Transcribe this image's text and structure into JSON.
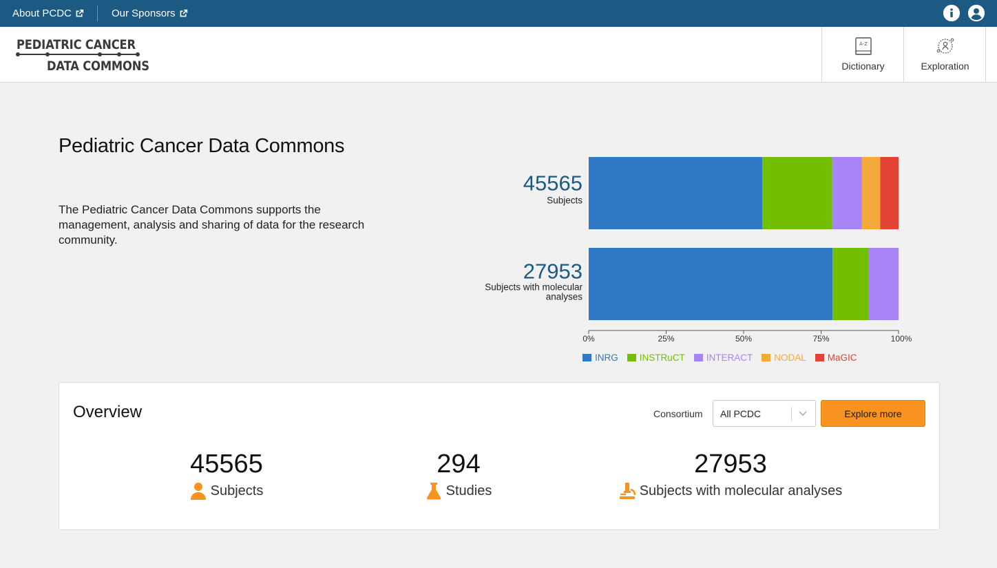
{
  "topbar": {
    "about_label": "About PCDC",
    "sponsors_label": "Our Sponsors",
    "info_icon": "info-circle-icon",
    "user_icon": "user-circle-icon"
  },
  "header": {
    "logo_line1": "PEDIATRIC CANCER",
    "logo_line2": "DATA COMMONS",
    "nav": [
      {
        "label": "Dictionary",
        "icon": "dictionary-book-icon"
      },
      {
        "label": "Exploration",
        "icon": "exploration-icon"
      }
    ]
  },
  "hero": {
    "title": "Pediatric Cancer Data Commons",
    "description": "The Pediatric Cancer Data Commons supports the management, analysis and sharing of data for the research community."
  },
  "chart_data": {
    "type": "bar",
    "orientation": "horizontal-stacked-percent",
    "categories": [
      "Subjects",
      "Subjects with molecular analyses"
    ],
    "category_totals": [
      "45565",
      "27953"
    ],
    "series": [
      {
        "name": "INRG",
        "color": "#2e78c4",
        "values": [
          56,
          78.7
        ]
      },
      {
        "name": "INSTRuCT",
        "color": "#72bf00",
        "values": [
          22.6,
          11.7
        ]
      },
      {
        "name": "INTERACT",
        "color": "#a885f7",
        "values": [
          9.6,
          9.6
        ]
      },
      {
        "name": "NODAL",
        "color": "#f3aa3b",
        "values": [
          5.9,
          0
        ]
      },
      {
        "name": "MaGIC",
        "color": "#e34234",
        "values": [
          5.9,
          0
        ]
      }
    ],
    "x_ticks": [
      "0%",
      "25%",
      "50%",
      "75%",
      "100%"
    ],
    "xlim": [
      0,
      100
    ],
    "legend": "bottom"
  },
  "overview": {
    "title": "Overview",
    "consortium_label": "Consortium",
    "consortium_value": "All PCDC",
    "explore_label": "Explore more",
    "stats": [
      {
        "value": "45565",
        "label": "Subjects",
        "icon": "user-icon"
      },
      {
        "value": "294",
        "label": "Studies",
        "icon": "flask-icon"
      },
      {
        "value": "27953",
        "label": "Subjects with molecular analyses",
        "icon": "microscope-icon"
      }
    ],
    "accent_color": "#f7931e"
  }
}
